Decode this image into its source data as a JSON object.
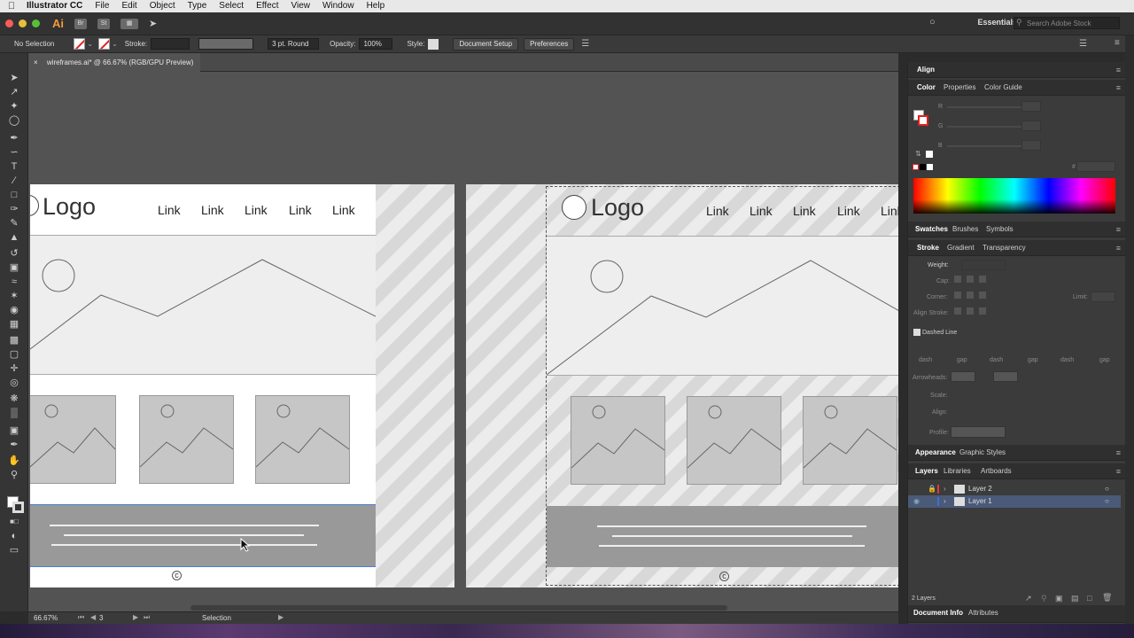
{
  "mac_menu": {
    "app": "Illustrator CC",
    "items": [
      "File",
      "Edit",
      "Object",
      "Type",
      "Select",
      "Effect",
      "View",
      "Window",
      "Help"
    ]
  },
  "appbar": {
    "app_icon": "Ai",
    "bridge": "Br",
    "stock": "St",
    "workspace": "Essentials",
    "search_placeholder": "Search Adobe Stock"
  },
  "control_bar": {
    "selection": "No Selection",
    "stroke_label": "Stroke:",
    "brush": "3 pt. Round",
    "opacity_label": "Opacity:",
    "opacity_value": "100%",
    "style_label": "Style:",
    "document_setup": "Document Setup",
    "preferences": "Preferences"
  },
  "doc_tab": {
    "close": "×",
    "title": "wireframes.ai* @ 66.67% (RGB/GPU Preview)"
  },
  "artboard": {
    "logo": "Logo",
    "links": [
      "Link",
      "Link",
      "Link",
      "Link",
      "Link"
    ],
    "copyright": "c"
  },
  "status_bar": {
    "zoom": "66.67%",
    "artboard_num": "3",
    "tool": "Selection"
  },
  "panels": {
    "align": "Align",
    "color_tabs": [
      "Color",
      "Properties",
      "Color Guide"
    ],
    "rgb": [
      "R",
      "G",
      "B"
    ],
    "hex_label": "#",
    "swatch_tabs": [
      "Swatches",
      "Brushes",
      "Symbols"
    ],
    "stroke_tabs": [
      "Stroke",
      "Gradient",
      "Transparency"
    ],
    "stroke": {
      "weight": "Weight:",
      "cap": "Cap:",
      "corner": "Corner:",
      "limit": "Limit:",
      "align_stroke": "Align Stroke:",
      "dashed_line": "Dashed Line",
      "dash_gap": [
        "dash",
        "gap",
        "dash",
        "gap",
        "dash",
        "gap"
      ],
      "arrowheads": "Arrowheads:",
      "scale": "Scale:",
      "align": "Align:",
      "profile": "Profile:"
    },
    "appearance_tabs": [
      "Appearance",
      "Graphic Styles"
    ],
    "layer_tabs": [
      "Layers",
      "Libraries",
      "Artboards"
    ],
    "layers": [
      {
        "name": "Layer 2",
        "color": "#e03a3a"
      },
      {
        "name": "Layer 1",
        "color": "#3a6fe0"
      }
    ],
    "layer_count": "2 Layers",
    "bottom_tabs": [
      "Document Info",
      "Attributes"
    ]
  }
}
